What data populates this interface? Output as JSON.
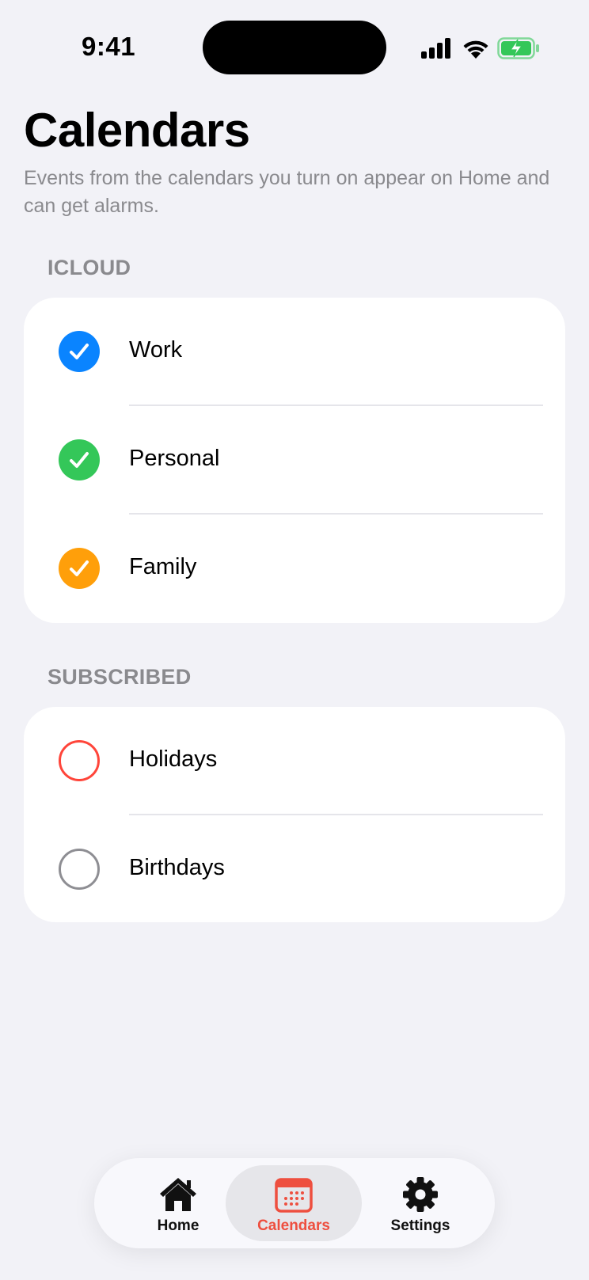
{
  "status_bar": {
    "time": "9:41",
    "icons": [
      "cellular-signal-icon",
      "wifi-icon",
      "battery-charging-icon"
    ]
  },
  "header": {
    "title": "Calendars",
    "subtitle": "Events from the calendars you turn on appear on Home and can get alarms."
  },
  "sections": [
    {
      "header": "ICLOUD",
      "items": [
        {
          "label": "Work",
          "checked": true,
          "color": "#0a84ff"
        },
        {
          "label": "Personal",
          "checked": true,
          "color": "#34c759"
        },
        {
          "label": "Family",
          "checked": true,
          "color": "#ff9f0a"
        }
      ]
    },
    {
      "header": "SUBSCRIBED",
      "items": [
        {
          "label": "Holidays",
          "checked": false,
          "color": "#ff453a"
        },
        {
          "label": "Birthdays",
          "checked": false,
          "color": "#8e8e93"
        }
      ]
    }
  ],
  "tab_bar": {
    "tabs": [
      {
        "label": "Home",
        "icon": "house-icon",
        "active": false
      },
      {
        "label": "Calendars",
        "icon": "calendar-icon",
        "active": true
      },
      {
        "label": "Settings",
        "icon": "gear-icon",
        "active": false
      }
    ],
    "active_color": "#ee4f3f",
    "inactive_color": "#111111"
  }
}
